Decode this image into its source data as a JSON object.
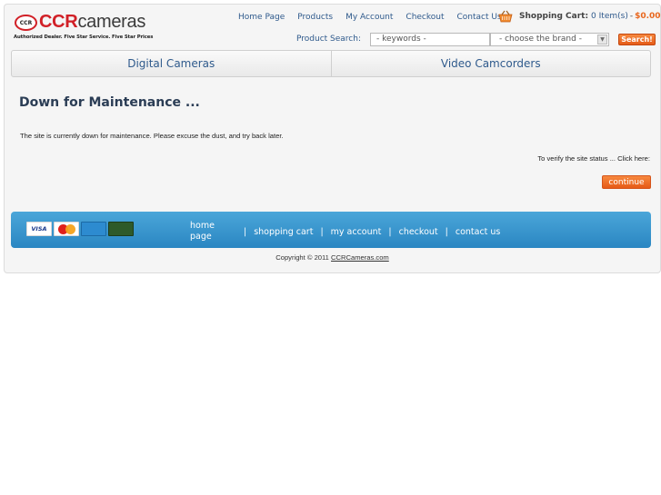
{
  "header": {
    "logo_badge": "CCR",
    "logo_brand_bold": "CCR",
    "logo_brand_rest": "cameras",
    "logo_tagline": "Authorized Dealer. Five Star Service. Five Star Prices",
    "nav": [
      "Home Page",
      "Products",
      "My Account",
      "Checkout",
      "Contact Us"
    ],
    "cart_label": "Shopping Cart:",
    "cart_items": "0 Item(s)",
    "cart_separator": "-",
    "cart_total": "$0.00",
    "search_label": "Product Search:",
    "search_placeholder": "- keywords -",
    "brand_select_value": "- choose the brand -",
    "search_button": "Search!"
  },
  "categories": [
    "Digital Cameras",
    "Video Camcorders"
  ],
  "content": {
    "title": "Down for Maintenance ...",
    "message": "The site is currently down for maintenance. Please excuse the dust, and try back later.",
    "verify_text": "To verify the site status ... Click here:",
    "continue_button": "continue"
  },
  "footer": {
    "cards": [
      "VISA",
      "MasterCard",
      "AMERICAN EXPRESS",
      "DISCOVER"
    ],
    "nav": [
      "home page",
      "shopping cart",
      "my account",
      "checkout",
      "contact us"
    ],
    "separator": "|",
    "copyright_prefix": "Copyright © 2011",
    "copyright_link": "CCRCameras.com"
  },
  "colors": {
    "accent_orange": "#e8671e",
    "link_blue": "#2f5a8c",
    "footer_blue": "#3a98d0",
    "brand_red": "#d12027"
  }
}
